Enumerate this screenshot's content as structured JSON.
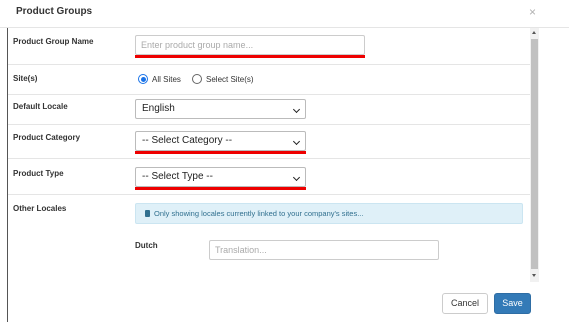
{
  "modal": {
    "title": "Product Groups",
    "close_glyph": "×"
  },
  "fields": {
    "product_group_name": {
      "label": "Product Group Name",
      "placeholder": "Enter product group name...",
      "value": ""
    },
    "sites": {
      "label": "Site(s)",
      "options": [
        {
          "label": "All Sites",
          "checked": true
        },
        {
          "label": "Select Site(s)",
          "checked": false
        }
      ]
    },
    "default_locale": {
      "label": "Default Locale",
      "value": "English"
    },
    "product_category": {
      "label": "Product Category",
      "value": "-- Select Category --"
    },
    "product_type": {
      "label": "Product Type",
      "value": "-- Select Type --"
    },
    "other_locales": {
      "label": "Other Locales",
      "info": "Only showing locales currently linked to your company's sites...",
      "locales": [
        {
          "name": "Dutch",
          "placeholder": "Translation..."
        }
      ]
    }
  },
  "footer": {
    "cancel_label": "Cancel",
    "save_label": "Save"
  },
  "colors": {
    "accent": "#337ab7",
    "radio_selected": "#1a73e8",
    "highlight_underline": "#e00000",
    "info_bg": "#dff0f8",
    "info_text": "#31708f"
  }
}
